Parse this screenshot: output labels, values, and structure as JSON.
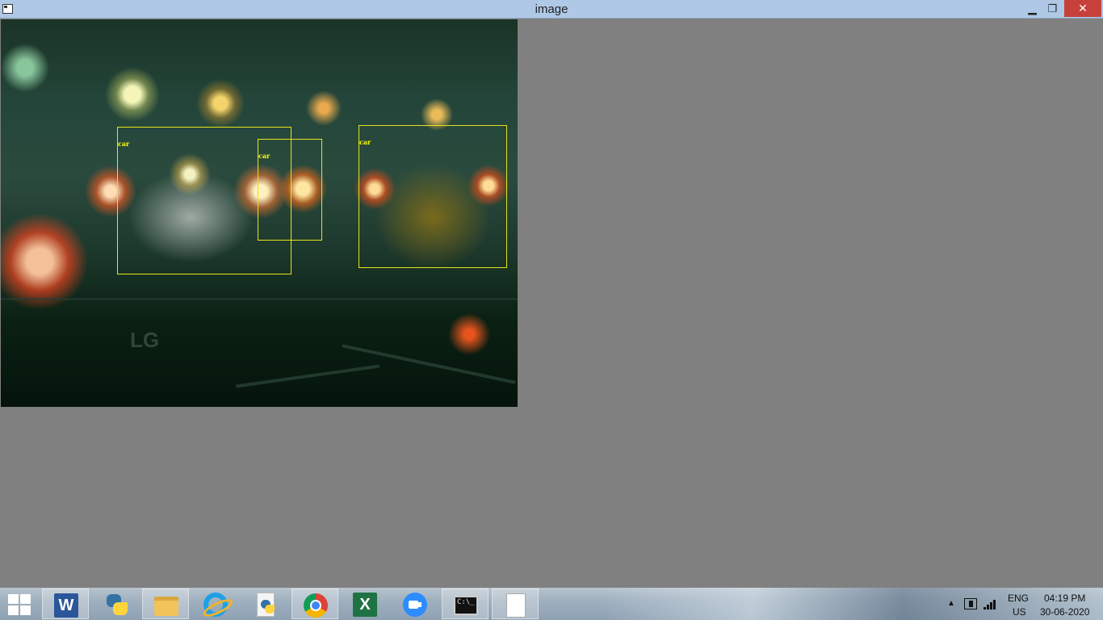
{
  "window": {
    "title": "image",
    "minimize_icon": "minimize-icon",
    "maximize_icon": "restore-icon",
    "close_icon": "close-icon"
  },
  "image": {
    "detections": [
      {
        "label": "car"
      },
      {
        "label": "car"
      },
      {
        "label": "car"
      }
    ],
    "box_color": "#e8e41c",
    "label_color": "#ffff00"
  },
  "taskbar": {
    "apps": [
      {
        "name": "Microsoft Word",
        "icon": "word-icon",
        "glyph": "W"
      },
      {
        "name": "Python IDLE",
        "icon": "python-idle-icon"
      },
      {
        "name": "File Explorer",
        "icon": "folder-icon"
      },
      {
        "name": "Internet Explorer",
        "icon": "internet-explorer-icon"
      },
      {
        "name": "Python",
        "icon": "python-icon"
      },
      {
        "name": "Google Chrome",
        "icon": "chrome-icon"
      },
      {
        "name": "Microsoft Excel",
        "icon": "excel-icon",
        "glyph": "X"
      },
      {
        "name": "Zoom",
        "icon": "zoom-icon"
      },
      {
        "name": "Command Prompt",
        "icon": "cmd-icon",
        "glyph": "C:\\_"
      },
      {
        "name": "image",
        "icon": "blank-window-icon"
      }
    ],
    "tray": {
      "language": "ENG",
      "region": "US",
      "time": "04:19 PM",
      "date": "30-06-2020",
      "show_hidden_glyph": "▲"
    }
  }
}
